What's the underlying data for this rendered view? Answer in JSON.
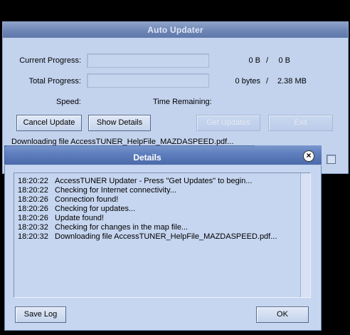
{
  "main_window": {
    "title": "Auto Updater",
    "current_progress": {
      "label": "Current Progress:",
      "value": 0,
      "done": "0 B",
      "sep": "/",
      "total": "0 B"
    },
    "total_progress": {
      "label": "Total Progress:",
      "value": 0,
      "done": "0 bytes",
      "sep": "/",
      "total": "2.38 MB"
    },
    "speed_label": "Speed:",
    "time_remaining_label": "Time Remaining:",
    "buttons": {
      "cancel_update": "Cancel Update",
      "show_details": "Show Details",
      "get_updates": "Get Updates",
      "exit": "Exit"
    },
    "status": "Downloading file AccessTUNER_HelpFile_MAZDASPEED.pdf..."
  },
  "details": {
    "title": "Details",
    "close_symbol": "×",
    "log": [
      {
        "time": "18:20:22",
        "message": "AccessTUNER Updater - Press \"Get Updates\" to begin..."
      },
      {
        "time": "18:20:22",
        "message": "Checking for Internet connectivity..."
      },
      {
        "time": "18:20:26",
        "message": "Connection found!"
      },
      {
        "time": "18:20:26",
        "message": "Checking for updates..."
      },
      {
        "time": "18:20:26",
        "message": "Update found!"
      },
      {
        "time": "18:20:32",
        "message": "Checking for changes in the map file..."
      },
      {
        "time": "18:20:32",
        "message": "Downloading file AccessTUNER_HelpFile_MAZDASPEED.pdf..."
      }
    ],
    "buttons": {
      "save_log": "Save Log",
      "ok": "OK"
    }
  }
}
